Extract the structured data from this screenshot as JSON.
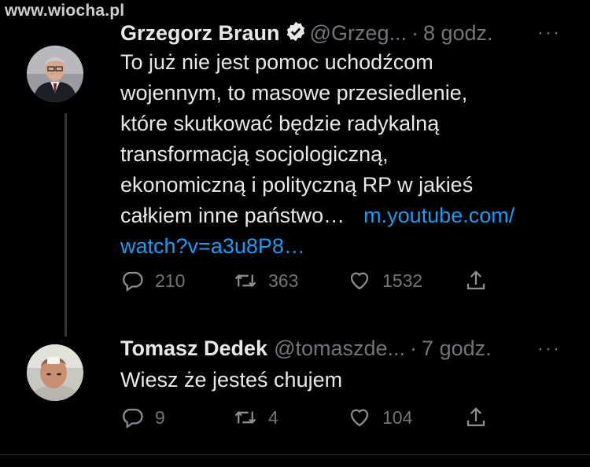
{
  "watermark": "www.wiocha.pl",
  "tweets": [
    {
      "name": "Grzegorz Braun",
      "handle": "@Grzeg...",
      "time": "8 godz.",
      "more": "···",
      "text_lines": [
        "To już nie jest pomoc uchodźcom",
        "wojennym, to masowe przesiedlenie,",
        "które skutkować będzie radykalną",
        "transformacją socjologiczną,",
        "ekonomiczną i polityczną RP w jakieś",
        "całkiem inne państwo…"
      ],
      "link_part1": "m.youtube.com/",
      "link_part2": "watch?v=a3u8P8…",
      "replies": "210",
      "retweets": "363",
      "likes": "1532"
    },
    {
      "name": "Tomasz Dedek",
      "handle": "@tomaszde...",
      "time": "7 godz.",
      "more": "···",
      "text": "Wiesz że jesteś chujem",
      "replies": "9",
      "retweets": "4",
      "likes": "104"
    }
  ],
  "separator": "·",
  "icons": {
    "reply": "reply-icon",
    "retweet": "retweet-icon",
    "like": "heart-icon",
    "share": "share-icon",
    "verified": "verified-badge-icon"
  },
  "colors": {
    "background": "#000000",
    "link": "#1d9bf0",
    "muted": "#71767b",
    "text": "#e7e9ea"
  }
}
